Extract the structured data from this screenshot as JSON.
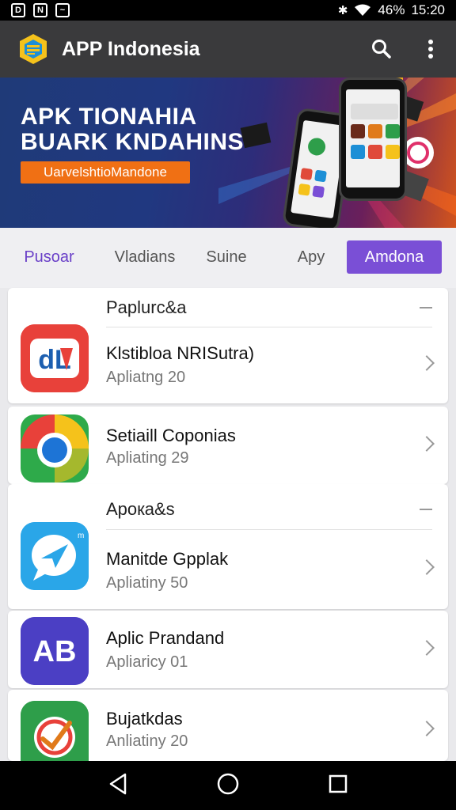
{
  "status_bar": {
    "left_icons": [
      "D",
      "N",
      "~"
    ],
    "battery": "46%",
    "time": "15:20"
  },
  "app_bar": {
    "title": "APP Indonesia",
    "icons": [
      "app-logo-icon",
      "search-icon",
      "more-vert-icon"
    ]
  },
  "banner": {
    "headline_line1": "APK TIONAHIA",
    "headline_line2": "BUARK KNDAHINS",
    "cta_label": "UarvelshtioMandone"
  },
  "tabs": [
    {
      "label": "Pusoar"
    },
    {
      "label": "Vladians"
    },
    {
      "label": "Suine"
    },
    {
      "label": "Apy"
    },
    {
      "label": "Amdona"
    }
  ],
  "sections": [
    {
      "title": "Paplurс&a",
      "items": [
        {
          "title": "Klstibloa NRISutra)",
          "subtitle": "Apliatng 20",
          "icon": "red-app-icon"
        },
        {
          "title": "Setiaill Coponias",
          "subtitle": "Apliating 29",
          "icon": "chrome-icon"
        }
      ]
    },
    {
      "title": "Apoкa&s",
      "items": [
        {
          "title": "Manitde Gpplak",
          "subtitle": "Apliatiny 50",
          "icon": "messenger-icon"
        },
        {
          "title": "Aplic Prandand",
          "subtitle": "Apliaricy 01",
          "icon": "ab-app-icon"
        },
        {
          "title": "Bujatkdas",
          "subtitle": "Anliatiny 20",
          "icon": "green-app-icon"
        }
      ]
    }
  ],
  "nav_bar": {
    "icons": [
      "back-icon",
      "home-icon",
      "recents-icon"
    ]
  },
  "colors": {
    "accent": "#7a4fd6",
    "app_bar": "#3a3a3c",
    "cta": "#f07014"
  }
}
